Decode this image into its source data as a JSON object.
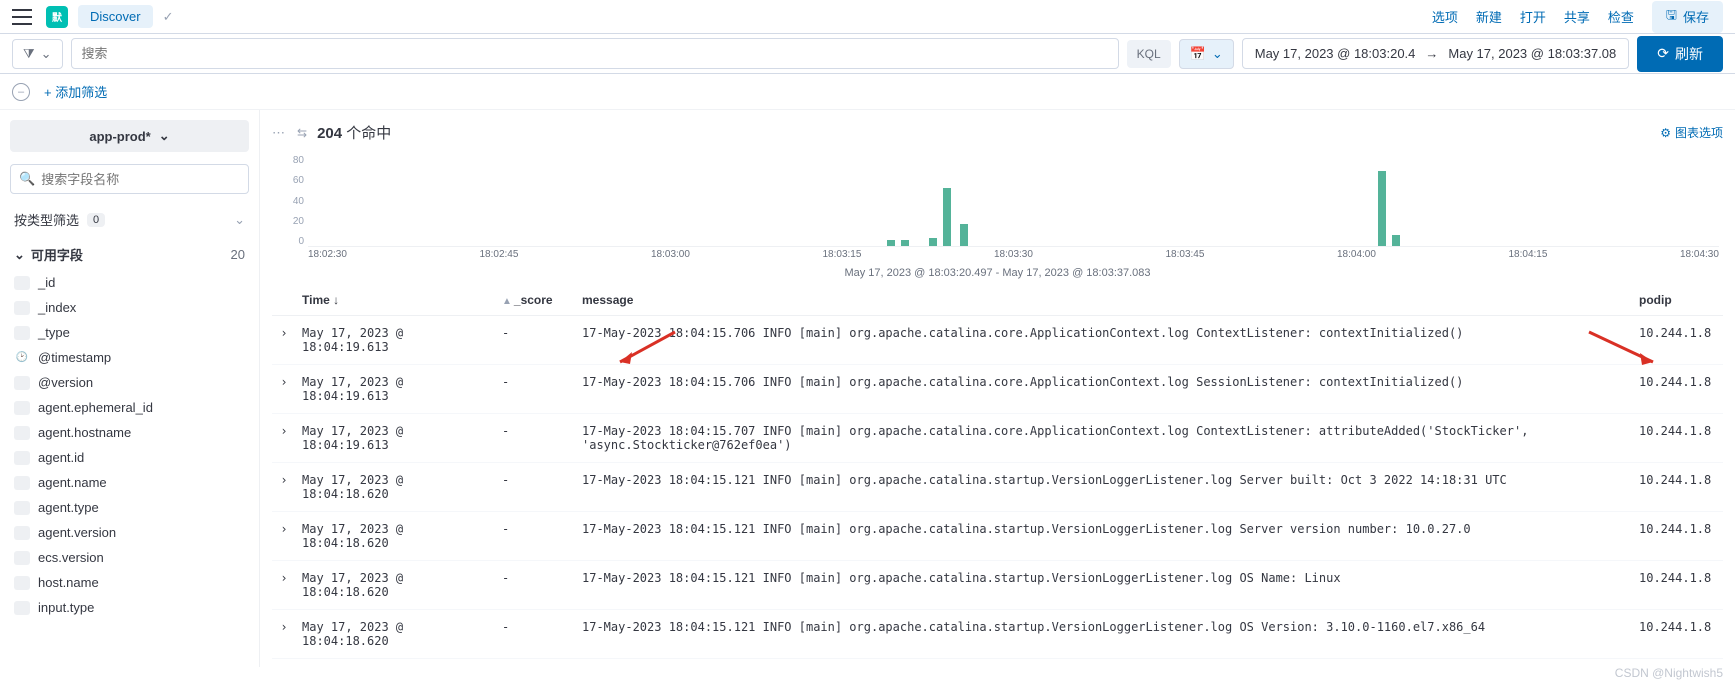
{
  "nav": {
    "logo_initial": "默",
    "app_name": "Discover",
    "links": [
      "选项",
      "新建",
      "打开",
      "共享",
      "检查"
    ],
    "save_label": "保存"
  },
  "search": {
    "placeholder": "搜索",
    "kql": "KQL",
    "time_from": "May 17, 2023 @ 18:03:20.4",
    "time_to": "May 17, 2023 @ 18:03:37.08",
    "refresh_label": "刷新"
  },
  "filter": {
    "add_label": "+ 添加筛选"
  },
  "sidebar": {
    "index_pattern": "app-prod*",
    "field_search_placeholder": "搜索字段名称",
    "type_filter_label": "按类型筛选",
    "type_filter_count": "0",
    "available_label": "可用字段",
    "available_count": "20",
    "fields": [
      "_id",
      "_index",
      "_type",
      "@timestamp",
      "@version",
      "agent.ephemeral_id",
      "agent.hostname",
      "agent.id",
      "agent.name",
      "agent.type",
      "agent.version",
      "ecs.version",
      "host.name",
      "input.type"
    ]
  },
  "content": {
    "hits_count": "204",
    "hits_suffix": "个命中",
    "chart_options_label": "图表选项",
    "chart_caption": "May 17, 2023 @ 18:03:20.497 - May 17, 2023 @ 18:03:37.083"
  },
  "columns": {
    "time": "Time",
    "score": "_score",
    "message": "message",
    "podip": "podip"
  },
  "rows": [
    {
      "time": "May 17, 2023 @ 18:04:19.613",
      "score": "-",
      "message": "17-May-2023 18:04:15.706 INFO [main] org.apache.catalina.core.ApplicationContext.log ContextListener: contextInitialized()",
      "podip": "10.244.1.8"
    },
    {
      "time": "May 17, 2023 @ 18:04:19.613",
      "score": "-",
      "message": "17-May-2023 18:04:15.706 INFO [main] org.apache.catalina.core.ApplicationContext.log SessionListener: contextInitialized()",
      "podip": "10.244.1.8"
    },
    {
      "time": "May 17, 2023 @ 18:04:19.613",
      "score": "-",
      "message": "17-May-2023 18:04:15.707 INFO [main] org.apache.catalina.core.ApplicationContext.log ContextListener: attributeAdded('StockTicker', 'async.Stockticker@762ef0ea')",
      "podip": "10.244.1.8"
    },
    {
      "time": "May 17, 2023 @ 18:04:18.620",
      "score": "-",
      "message": "17-May-2023 18:04:15.121 INFO [main] org.apache.catalina.startup.VersionLoggerListener.log Server built:          Oct 3 2022 14:18:31 UTC",
      "podip": "10.244.1.8"
    },
    {
      "time": "May 17, 2023 @ 18:04:18.620",
      "score": "-",
      "message": "17-May-2023 18:04:15.121 INFO [main] org.apache.catalina.startup.VersionLoggerListener.log Server version number: 10.0.27.0",
      "podip": "10.244.1.8"
    },
    {
      "time": "May 17, 2023 @ 18:04:18.620",
      "score": "-",
      "message": "17-May-2023 18:04:15.121 INFO [main] org.apache.catalina.startup.VersionLoggerListener.log OS Name:               Linux",
      "podip": "10.244.1.8"
    },
    {
      "time": "May 17, 2023 @ 18:04:18.620",
      "score": "-",
      "message": "17-May-2023 18:04:15.121 INFO [main] org.apache.catalina.startup.VersionLoggerListener.log OS Version:            3.10.0-1160.el7.x86_64",
      "podip": "10.244.1.8"
    }
  ],
  "chart_data": {
    "type": "bar",
    "ylim": [
      0,
      80
    ],
    "y_ticks": [
      "80",
      "60",
      "40",
      "20",
      "0"
    ],
    "x_ticks": [
      "18:02:30",
      "18:02:45",
      "18:03:00",
      "18:03:15",
      "18:03:30",
      "18:03:45",
      "18:04:00",
      "18:04:15",
      "18:04:30"
    ],
    "bars": [
      {
        "x_pct": 41.0,
        "h_pct": 7
      },
      {
        "x_pct": 42.0,
        "h_pct": 7
      },
      {
        "x_pct": 44.0,
        "h_pct": 9
      },
      {
        "x_pct": 45.0,
        "h_pct": 64
      },
      {
        "x_pct": 46.2,
        "h_pct": 24
      },
      {
        "x_pct": 75.8,
        "h_pct": 82
      },
      {
        "x_pct": 76.8,
        "h_pct": 12
      }
    ]
  },
  "watermark": "CSDN @Nightwish5"
}
